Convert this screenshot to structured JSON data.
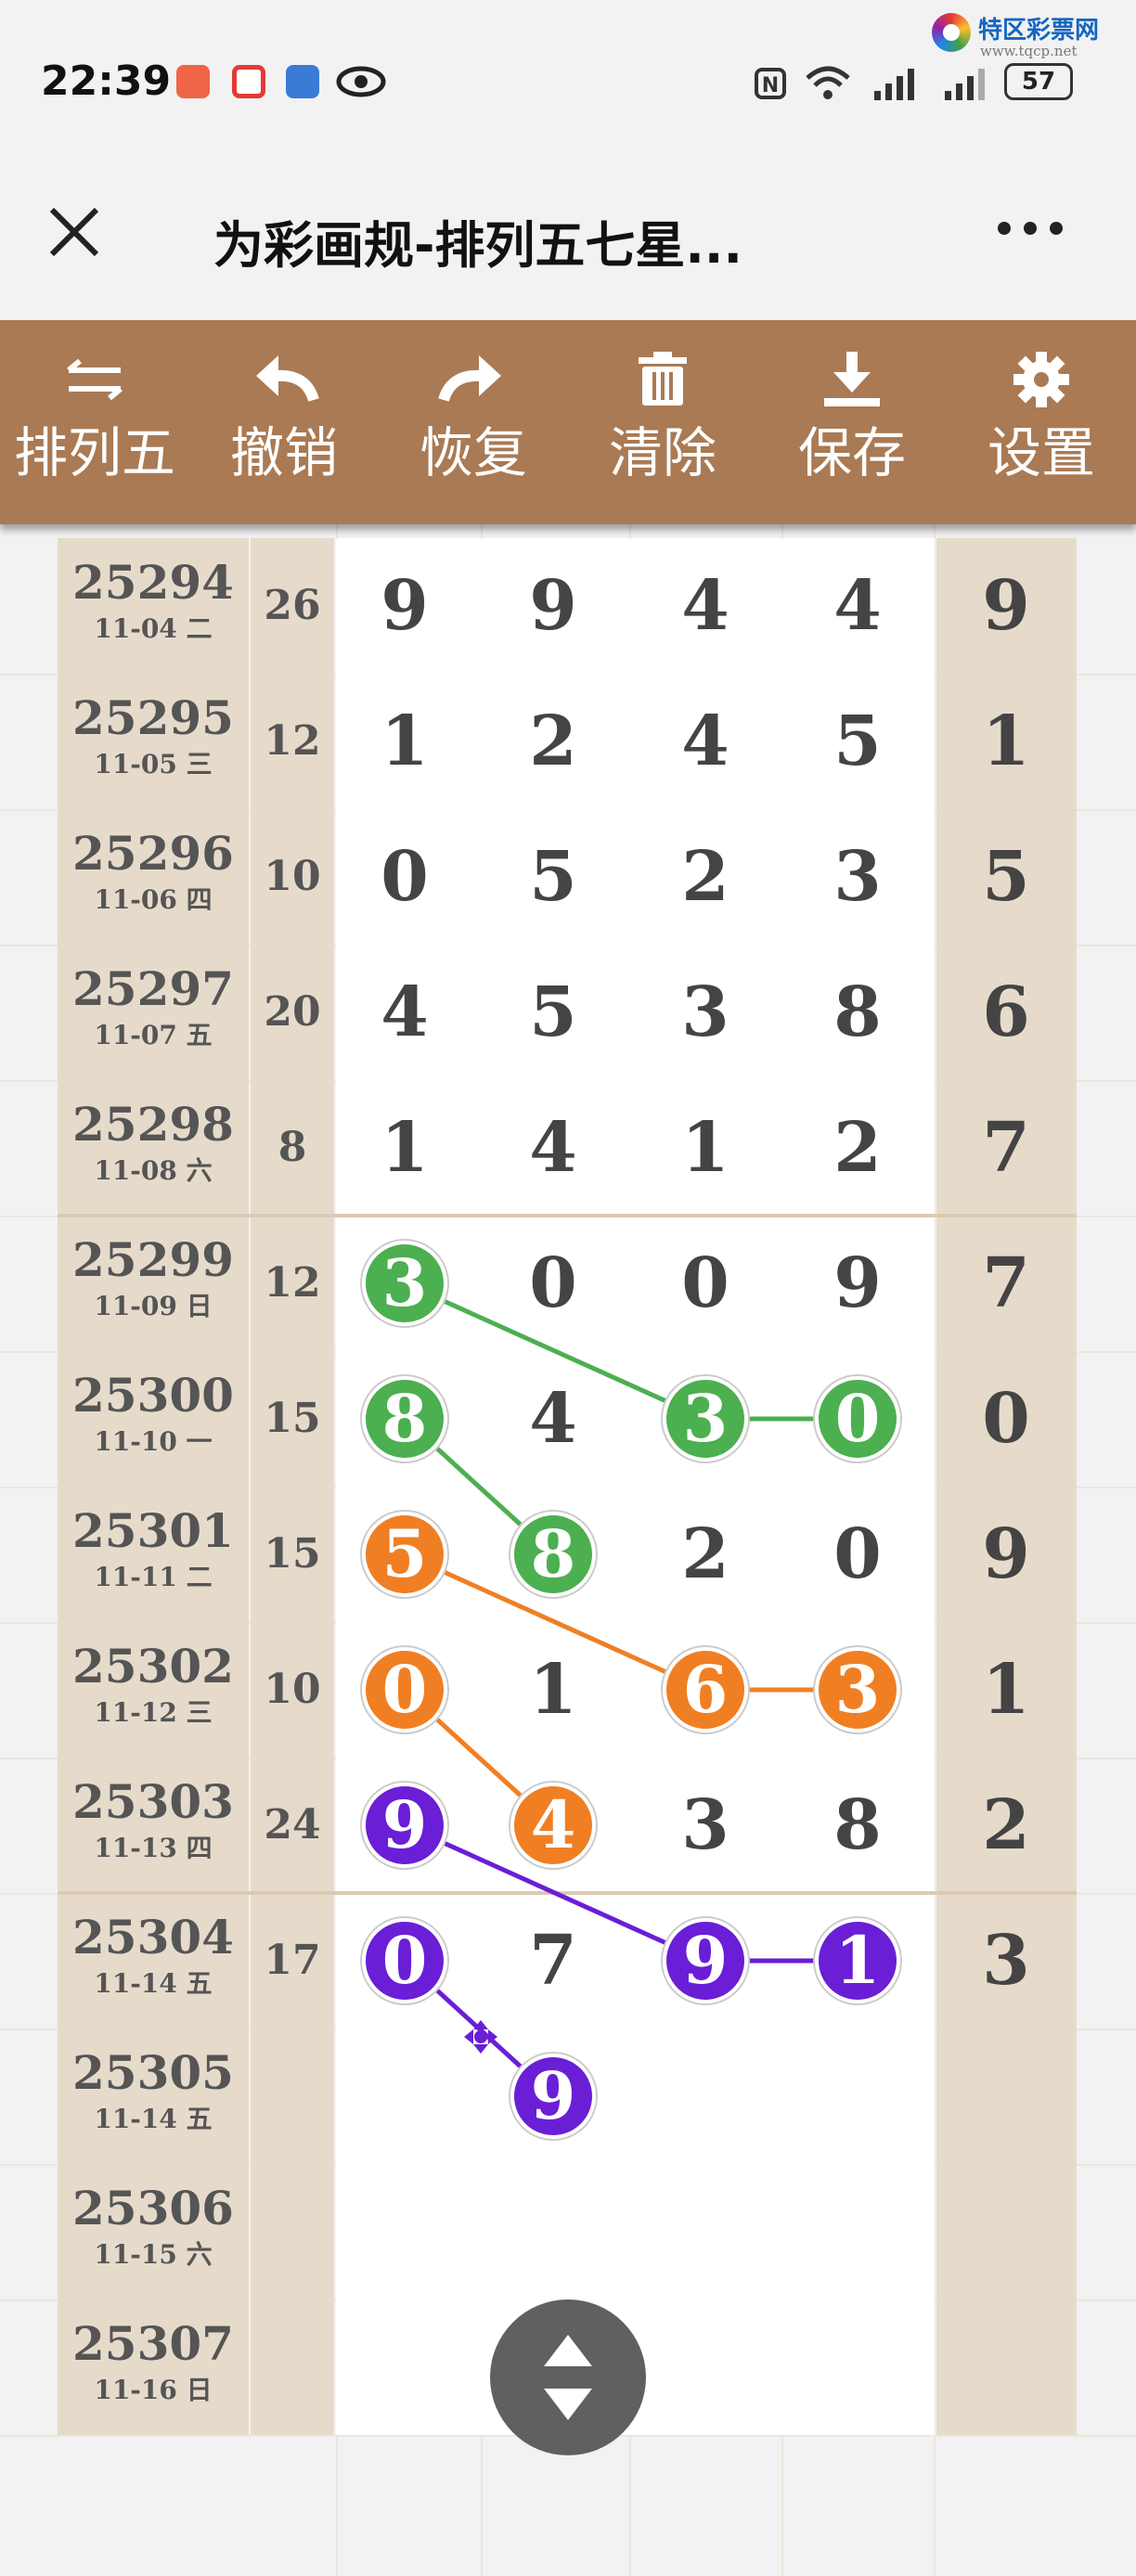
{
  "status_bar": {
    "time": "22:39",
    "battery": "57"
  },
  "watermark": {
    "name": "特区彩票网",
    "url": "www.tqcp.net"
  },
  "header": {
    "close_icon": "close-icon",
    "title": "为彩画规-排列五七星...",
    "more_icon": "more-icon"
  },
  "toolbar": [
    {
      "label": "排列五",
      "icon": "swap-icon"
    },
    {
      "label": "撤销",
      "icon": "undo-icon"
    },
    {
      "label": "恢复",
      "icon": "redo-icon"
    },
    {
      "label": "清除",
      "icon": "trash-icon"
    },
    {
      "label": "保存",
      "icon": "download-icon"
    },
    {
      "label": "设置",
      "icon": "gear-icon"
    }
  ],
  "rows": [
    {
      "issue": "25294",
      "date": "11-04 二",
      "sum": "26",
      "d": [
        "9",
        "9",
        "4",
        "4",
        "9"
      ]
    },
    {
      "issue": "25295",
      "date": "11-05 三",
      "sum": "12",
      "d": [
        "1",
        "2",
        "4",
        "5",
        "1"
      ]
    },
    {
      "issue": "25296",
      "date": "11-06 四",
      "sum": "10",
      "d": [
        "0",
        "5",
        "2",
        "3",
        "5"
      ]
    },
    {
      "issue": "25297",
      "date": "11-07 五",
      "sum": "20",
      "d": [
        "4",
        "5",
        "3",
        "8",
        "6"
      ]
    },
    {
      "issue": "25298",
      "date": "11-08 六",
      "sum": "8",
      "d": [
        "1",
        "4",
        "1",
        "2",
        "7"
      ]
    },
    {
      "issue": "25299",
      "date": "11-09 日",
      "sum": "12",
      "d": [
        "3",
        "0",
        "0",
        "9",
        "7"
      ]
    },
    {
      "issue": "25300",
      "date": "11-10 一",
      "sum": "15",
      "d": [
        "8",
        "4",
        "3",
        "0",
        "0"
      ]
    },
    {
      "issue": "25301",
      "date": "11-11 二",
      "sum": "15",
      "d": [
        "5",
        "8",
        "2",
        "0",
        "9"
      ]
    },
    {
      "issue": "25302",
      "date": "11-12 三",
      "sum": "10",
      "d": [
        "0",
        "1",
        "6",
        "3",
        "1"
      ]
    },
    {
      "issue": "25303",
      "date": "11-13 四",
      "sum": "24",
      "d": [
        "9",
        "4",
        "3",
        "8",
        "2"
      ]
    },
    {
      "issue": "25304",
      "date": "11-14 五",
      "sum": "17",
      "d": [
        "0",
        "7",
        "9",
        "1",
        "3"
      ]
    },
    {
      "issue": "25305",
      "date": "11-14 五",
      "sum": "",
      "d": [
        "",
        "9",
        "",
        "",
        ""
      ]
    },
    {
      "issue": "25306",
      "date": "11-15 六",
      "sum": "",
      "d": [
        "",
        "",
        "",
        "",
        ""
      ]
    },
    {
      "issue": "25307",
      "date": "11-16 日",
      "sum": "",
      "d": [
        "",
        "",
        "",
        "",
        ""
      ]
    }
  ],
  "highlights": [
    {
      "row": 5,
      "col": 0,
      "color": "green"
    },
    {
      "row": 6,
      "col": 0,
      "color": "green"
    },
    {
      "row": 6,
      "col": 2,
      "color": "green"
    },
    {
      "row": 6,
      "col": 3,
      "color": "green"
    },
    {
      "row": 7,
      "col": 1,
      "color": "green"
    },
    {
      "row": 7,
      "col": 0,
      "color": "orange"
    },
    {
      "row": 8,
      "col": 0,
      "color": "orange"
    },
    {
      "row": 8,
      "col": 2,
      "color": "orange"
    },
    {
      "row": 8,
      "col": 3,
      "color": "orange"
    },
    {
      "row": 9,
      "col": 1,
      "color": "orange"
    },
    {
      "row": 9,
      "col": 0,
      "color": "purple"
    },
    {
      "row": 10,
      "col": 0,
      "color": "purple"
    },
    {
      "row": 10,
      "col": 2,
      "color": "purple"
    },
    {
      "row": 10,
      "col": 3,
      "color": "purple"
    },
    {
      "row": 11,
      "col": 1,
      "color": "purple"
    }
  ],
  "connections": [
    {
      "from": [
        5,
        0
      ],
      "to": [
        6,
        2
      ],
      "color": "green"
    },
    {
      "from": [
        6,
        2
      ],
      "to": [
        6,
        3
      ],
      "color": "green"
    },
    {
      "from": [
        6,
        0
      ],
      "to": [
        7,
        1
      ],
      "color": "green"
    },
    {
      "from": [
        7,
        0
      ],
      "to": [
        8,
        2
      ],
      "color": "orange"
    },
    {
      "from": [
        8,
        2
      ],
      "to": [
        8,
        3
      ],
      "color": "orange"
    },
    {
      "from": [
        8,
        0
      ],
      "to": [
        9,
        1
      ],
      "color": "orange"
    },
    {
      "from": [
        9,
        0
      ],
      "to": [
        10,
        2
      ],
      "color": "purple"
    },
    {
      "from": [
        10,
        2
      ],
      "to": [
        10,
        3
      ],
      "color": "purple"
    },
    {
      "from": [
        10,
        0
      ],
      "to": [
        11,
        1
      ],
      "color": "purple"
    }
  ],
  "colors": {
    "green": "#4caf50",
    "orange": "#f07f23",
    "purple": "#6a1ed6",
    "toolbar": "#a97a54"
  },
  "fab_icon": "scroll-updown-icon"
}
